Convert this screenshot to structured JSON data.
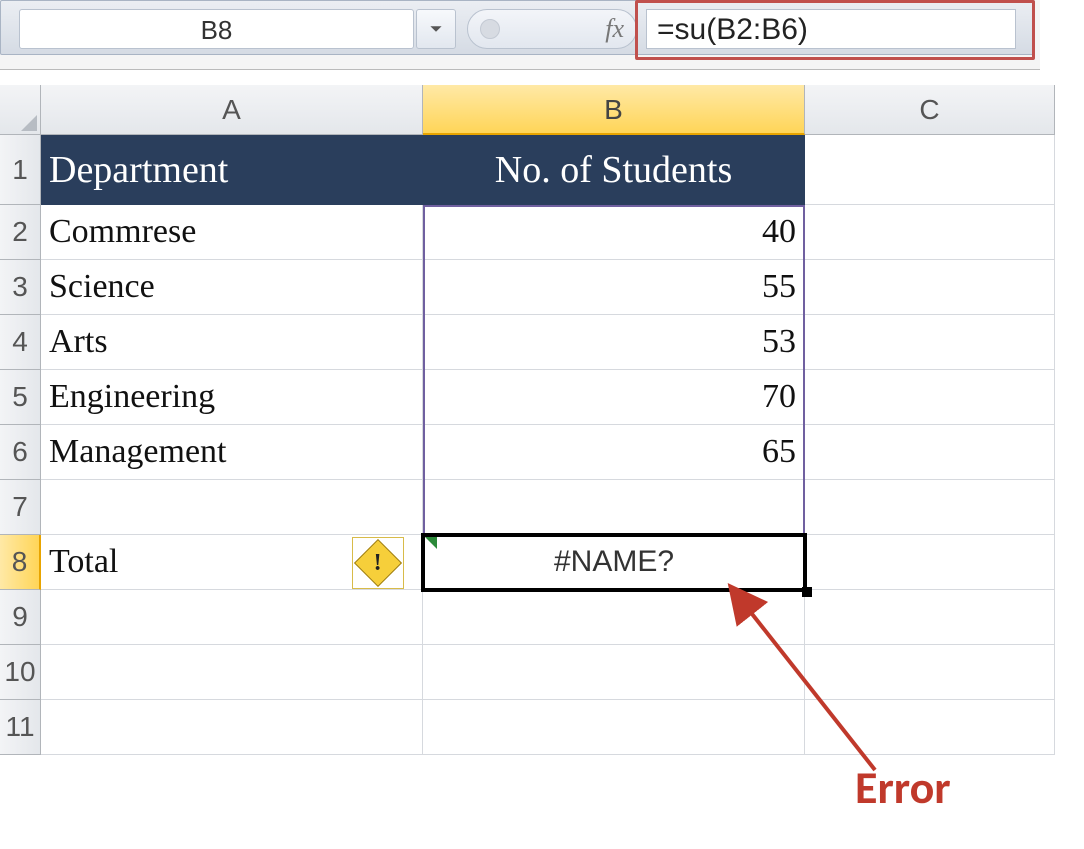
{
  "namebox": {
    "value": "B8"
  },
  "fx": {
    "label": "fx"
  },
  "formula": {
    "value": "=su(B2:B6)"
  },
  "columns": {
    "A": "A",
    "B": "B",
    "C": "C"
  },
  "rows": [
    "1",
    "2",
    "3",
    "4",
    "5",
    "6",
    "7",
    "8",
    "9",
    "10",
    "11"
  ],
  "header": {
    "A": "Department",
    "B": "No. of Students"
  },
  "data": {
    "r2": {
      "A": "Commrese",
      "B": "40"
    },
    "r3": {
      "A": "Science",
      "B": "55"
    },
    "r4": {
      "A": "Arts",
      "B": "53"
    },
    "r5": {
      "A": "Engineering",
      "B": "70"
    },
    "r6": {
      "A": "Management",
      "B": "65"
    },
    "r7": {
      "A": "",
      "B": ""
    },
    "r8": {
      "A": "Total",
      "B": "#NAME?"
    }
  },
  "smarttag": {
    "glyph": "!"
  },
  "annotation": {
    "label": "Error"
  },
  "active": {
    "col": "B",
    "row": "8"
  },
  "chart_data": {
    "type": "table",
    "title": "No. of Students by Department",
    "columns": [
      "Department",
      "No. of Students"
    ],
    "rows": [
      [
        "Commrese",
        40
      ],
      [
        "Science",
        55
      ],
      [
        "Arts",
        53
      ],
      [
        "Engineering",
        70
      ],
      [
        "Management",
        65
      ]
    ],
    "total": {
      "label": "Total",
      "value": "#NAME?",
      "formula": "=su(B2:B6)",
      "error": true
    }
  }
}
